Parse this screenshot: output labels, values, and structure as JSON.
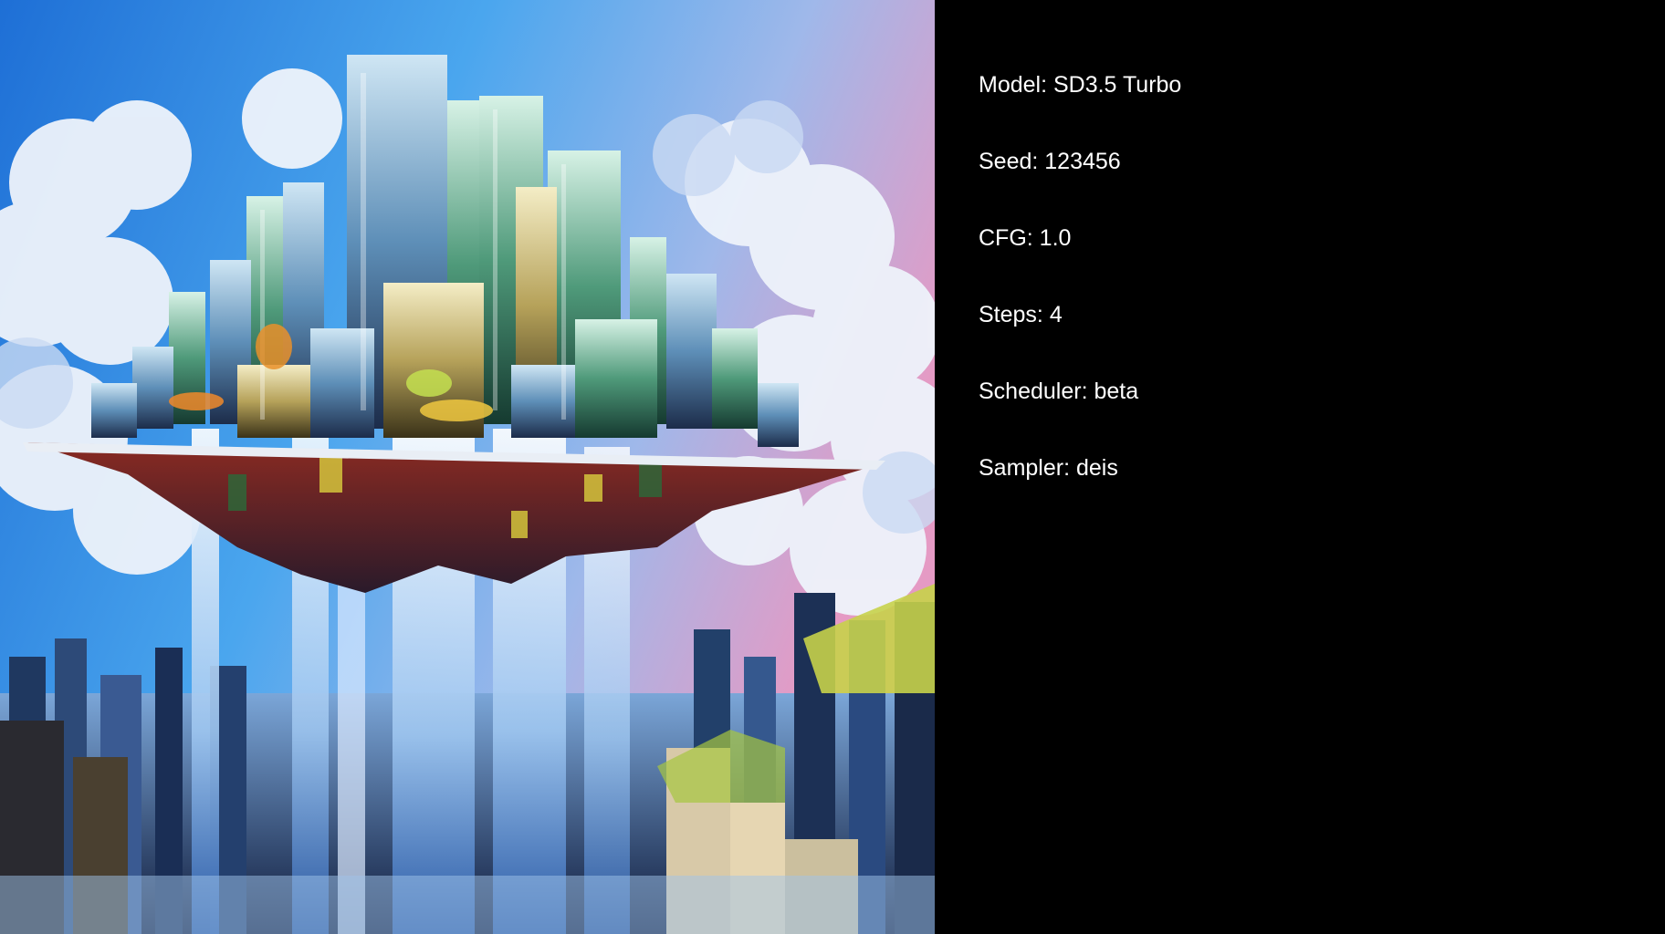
{
  "info_panel": {
    "lines": [
      "Model: SD3.5 Turbo",
      "Seed: 123456",
      "CFG: 1.0",
      "Steps: 4",
      "Scheduler: beta",
      "Sampler: deis"
    ]
  },
  "colors": {
    "background": "#000000",
    "text": "#ffffff"
  }
}
